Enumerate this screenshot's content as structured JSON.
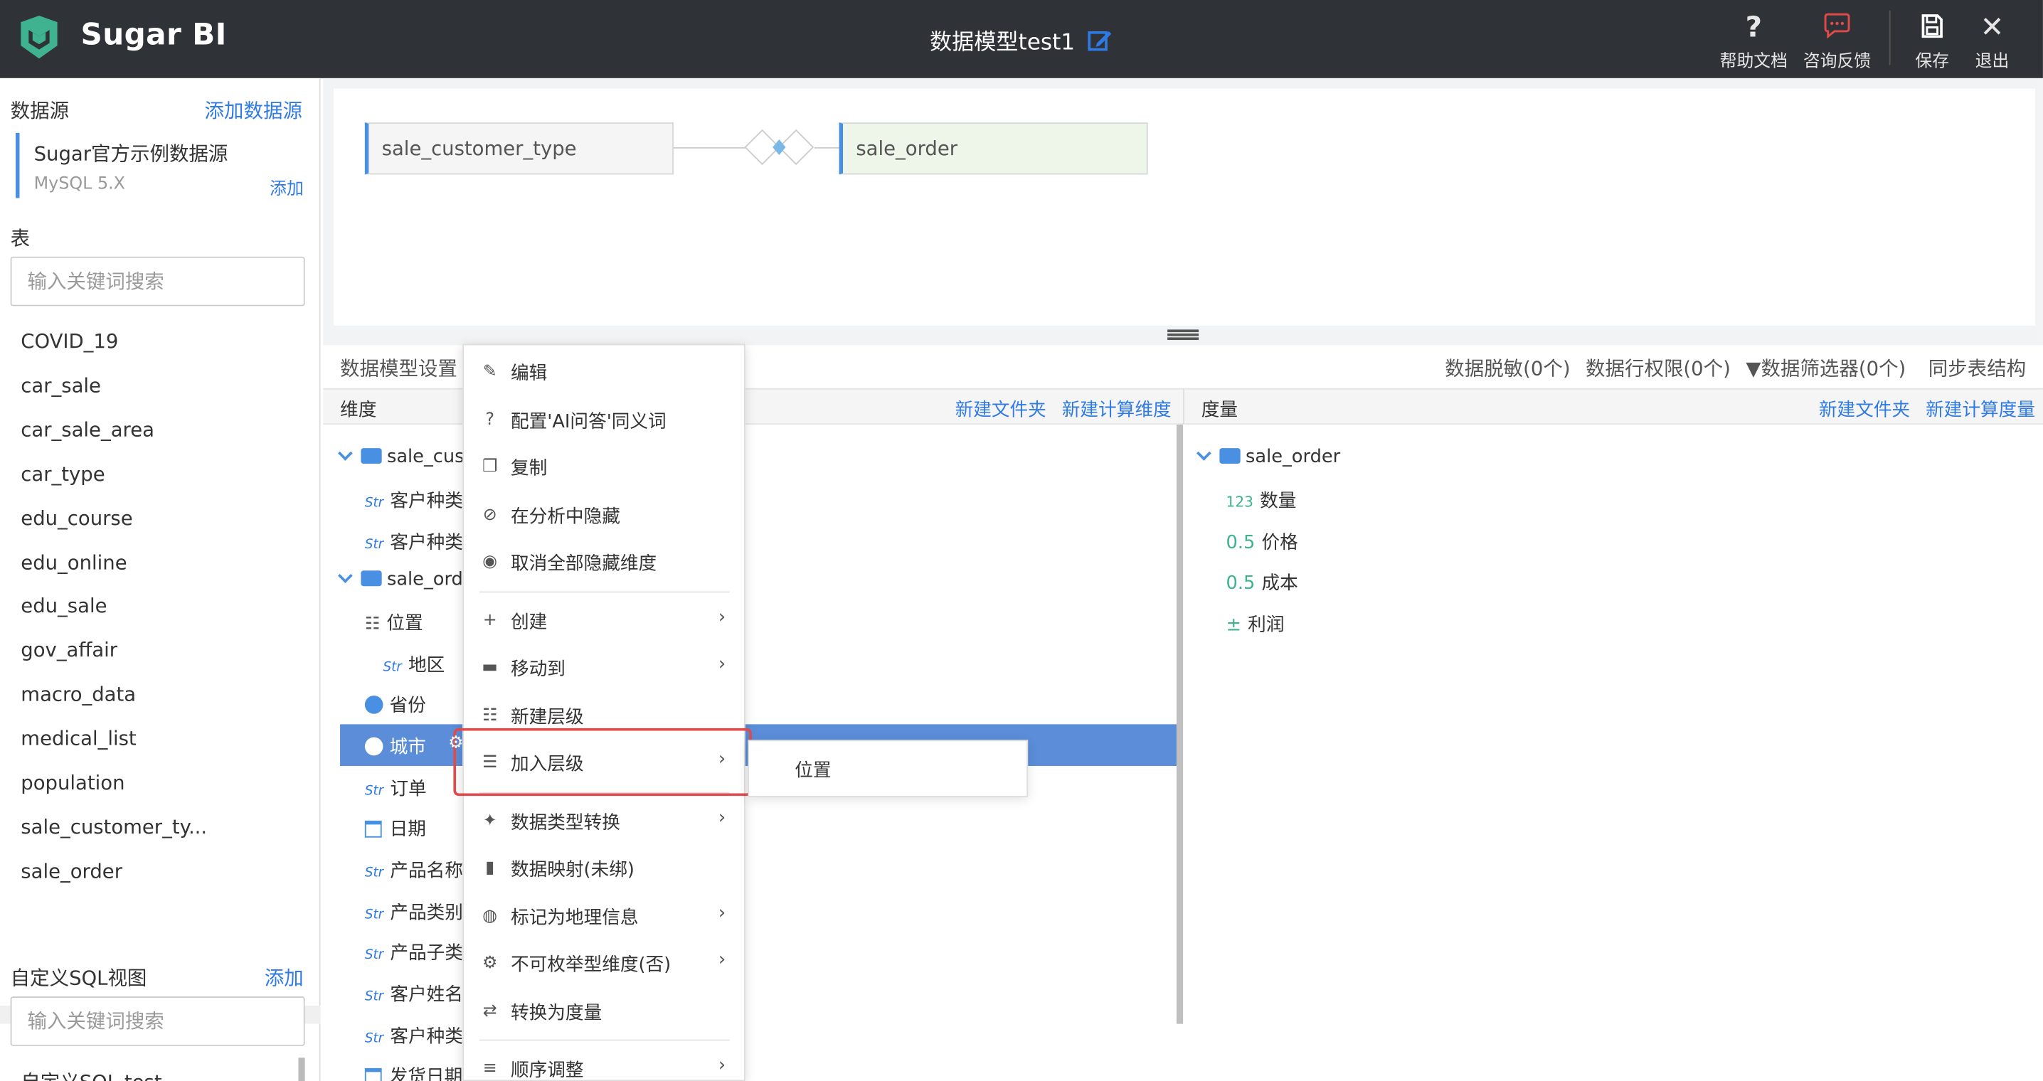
{
  "header": {
    "app_name": "Sugar BI",
    "model_title": "数据模型test1",
    "help_label": "帮助文档",
    "feedback_label": "咨询反馈",
    "save_label": "保存",
    "exit_label": "退出"
  },
  "left_panel": {
    "datasource_label": "数据源",
    "add_datasource": "添加数据源",
    "datasource_name": "Sugar官方示例数据源",
    "datasource_type": "MySQL 5.X",
    "add_link": "添加",
    "tables_label": "表",
    "search_placeholder": "输入关键词搜索",
    "tables": [
      "COVID_19",
      "car_sale",
      "car_sale_area",
      "car_type",
      "edu_course",
      "edu_online",
      "edu_sale",
      "gov_affair",
      "macro_data",
      "medical_list",
      "population",
      "sale_customer_ty...",
      "sale_order"
    ],
    "sql_view_label": "自定义SQL视图",
    "sql_add": "添加",
    "sql_search_placeholder": "输入关键词搜索",
    "sql_item": "自定义SQL test"
  },
  "canvas": {
    "left_table": "sale_customer_type",
    "right_table": "sale_order"
  },
  "settings_bar": {
    "title": "数据模型设置",
    "masking": "数据脱敏(0个)",
    "row_perm": "数据行权限(0个)",
    "filter": "数据筛选器(0个)",
    "sync": "同步表结构"
  },
  "dimensions": {
    "header": "维度",
    "new_folder": "新建文件夹",
    "new_calc": "新建计算维度",
    "items": [
      {
        "type": "folder",
        "label": "sale_cus"
      },
      {
        "type": "str",
        "label": "客户种类"
      },
      {
        "type": "str",
        "label": "客户种类"
      },
      {
        "type": "folder",
        "label": "sale_orde"
      },
      {
        "type": "hier",
        "label": "位置"
      },
      {
        "type": "str",
        "label": "地区"
      },
      {
        "type": "geo",
        "label": "省份"
      },
      {
        "type": "geo",
        "label": "城市"
      },
      {
        "type": "str",
        "label": "订单"
      },
      {
        "type": "date",
        "label": "日期"
      },
      {
        "type": "str",
        "label": "产品名称"
      },
      {
        "type": "str",
        "label": "产品类别"
      },
      {
        "type": "str",
        "label": "产品子类"
      },
      {
        "type": "str",
        "label": "客户姓名"
      },
      {
        "type": "str",
        "label": "客户种类"
      },
      {
        "type": "date",
        "label": "发货日期"
      }
    ]
  },
  "measures": {
    "header": "度量",
    "new_folder": "新建文件夹",
    "new_calc": "新建计算度量",
    "folder": "sale_order",
    "items": [
      {
        "tag": "123",
        "label": "数量"
      },
      {
        "tag": "0.5",
        "label": "价格"
      },
      {
        "tag": "0.5",
        "label": "成本"
      },
      {
        "tag": "±",
        "label": "利润"
      }
    ]
  },
  "context_menu": {
    "items": [
      {
        "icon": "edit-icon",
        "label": "编辑",
        "arrow": false
      },
      {
        "icon": "question-icon",
        "label": "配置'AI问答'同义词",
        "arrow": false
      },
      {
        "icon": "copy-icon",
        "label": "复制",
        "arrow": false
      },
      {
        "icon": "eye-off-icon",
        "label": "在分析中隐藏",
        "arrow": false
      },
      {
        "icon": "eye-icon",
        "label": "取消全部隐藏维度",
        "arrow": false
      },
      {
        "icon": "plus-icon",
        "label": "创建",
        "arrow": true
      },
      {
        "icon": "folder-icon",
        "label": "移动到",
        "arrow": true
      },
      {
        "icon": "hierarchy-icon",
        "label": "新建层级",
        "arrow": false
      },
      {
        "icon": "list-icon",
        "label": "加入层级",
        "arrow": true
      },
      {
        "icon": "wand-icon",
        "label": "数据类型转换",
        "arrow": true
      },
      {
        "icon": "book-icon",
        "label": "数据映射(未绑)",
        "arrow": false
      },
      {
        "icon": "globe-icon",
        "label": "标记为地理信息",
        "arrow": true
      },
      {
        "icon": "gear-icon",
        "label": "不可枚举型维度(否)",
        "arrow": true
      },
      {
        "icon": "swap-icon",
        "label": "转换为度量",
        "arrow": false
      },
      {
        "icon": "menu-icon",
        "label": "顺序调整",
        "arrow": true
      }
    ],
    "submenu_item": "位置"
  },
  "colors": {
    "header_bg": "#2f3237",
    "accent": "#2f7ae5",
    "selected_row": "#5b8dd9",
    "highlight": "#e04a4a"
  }
}
